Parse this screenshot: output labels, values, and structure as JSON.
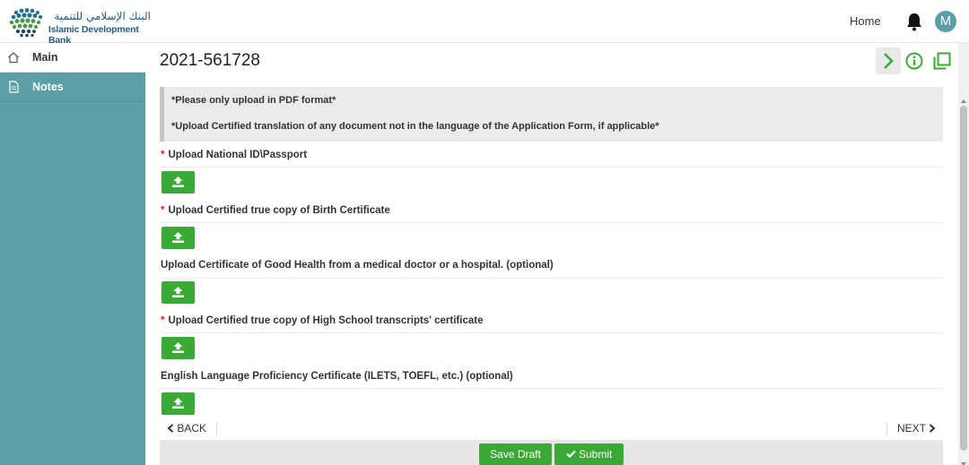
{
  "header": {
    "logo_arabic": "البنك الإسلامي للتنمية",
    "logo_english": "Islamic Development Bank",
    "home_link": "Home",
    "user_initial": "M"
  },
  "sidebar": {
    "items": [
      {
        "label": "Main",
        "icon": "home-icon"
      },
      {
        "label": "Notes",
        "icon": "document-icon"
      }
    ]
  },
  "main": {
    "application_number": "2021-561728",
    "notices": [
      "*Please only upload in PDF format*",
      "*Upload Certified translation of any document not in the language of the Application Form, if applicable*"
    ],
    "uploads": [
      {
        "label": "Upload National ID\\Passport",
        "required": true
      },
      {
        "label": "Upload Certified true copy of Birth Certificate",
        "required": true
      },
      {
        "label": "Upload Certificate of Good Health from a medical doctor or a hospital. (optional)",
        "required": false
      },
      {
        "label": "Upload Certified true copy of High School transcripts' certificate",
        "required": true
      },
      {
        "label": "English Language Proficiency Certificate (ILETS, TOEFL, etc.) (optional)",
        "required": false
      }
    ],
    "required_marker": "*",
    "back_label": "BACK",
    "next_label": "NEXT",
    "save_draft_label": "Save Draft",
    "submit_label": "Submit"
  },
  "colors": {
    "sidebar": "#5a9ea6",
    "button_green": "#3aa936",
    "required_red": "#d9232d",
    "brand_blue": "#1f5f86"
  }
}
